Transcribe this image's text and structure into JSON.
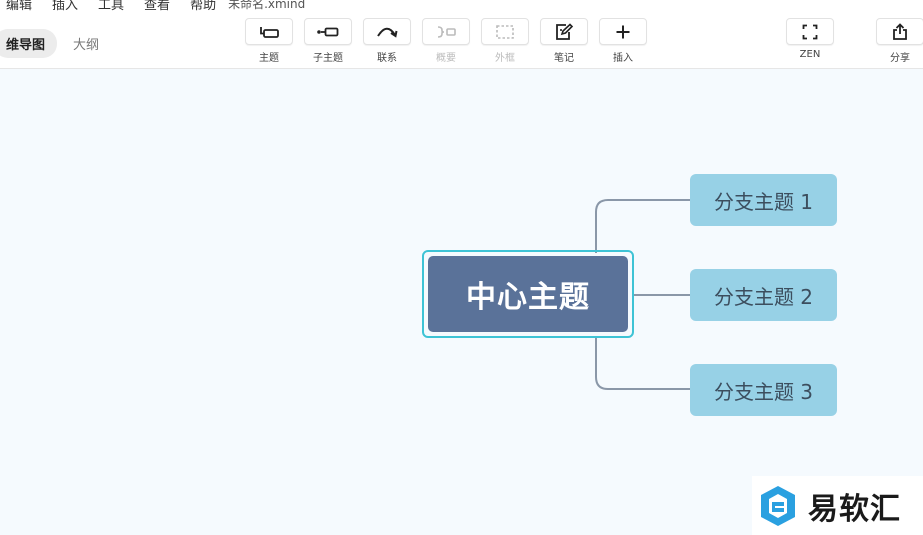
{
  "menu": {
    "items": [
      "编辑",
      "插入",
      "工具",
      "查看",
      "帮助"
    ],
    "file_title": "未命名.xmind"
  },
  "view_tabs": {
    "active": "维导图",
    "inactive": "大纲"
  },
  "toolbar": {
    "topic": "主题",
    "subtopic": "子主题",
    "relationship": "联系",
    "summary": "概要",
    "boundary": "外框",
    "note": "笔记",
    "insert": "插入",
    "zen": "ZEN",
    "share": "分享"
  },
  "mindmap": {
    "central_topic": "中心主题",
    "branches": [
      "分支主题 1",
      "分支主题 2",
      "分支主题 3"
    ]
  },
  "watermark": {
    "text": "易软汇"
  },
  "colors": {
    "central_fill": "#5a7299",
    "central_outline": "#3ec3d5",
    "branch_fill": "#97d1e6",
    "connector": "#8a97a8",
    "canvas_bg": "#f5fafe",
    "watermark_logo": "#2aa0e0"
  },
  "icons": {
    "topic": "topic-icon",
    "subtopic": "subtopic-icon",
    "relationship": "relationship-curve-icon",
    "summary": "summary-bracket-icon",
    "boundary": "boundary-dashed-box-icon",
    "note": "note-edit-icon",
    "insert": "plus-icon",
    "zen": "fullscreen-icon",
    "share": "share-icon"
  }
}
